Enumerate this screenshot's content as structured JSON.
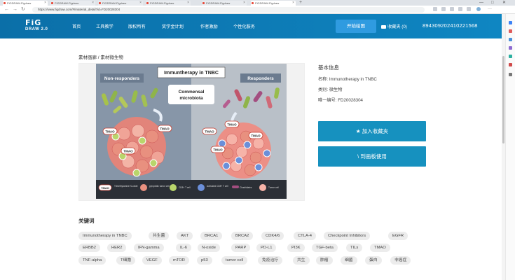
{
  "browser": {
    "tabs": [
      "FIGDRAW-Figdraw",
      "FIGDRAW-Figdraw",
      "FIGDRAW-Figdraw",
      "FIGDRAW-Figdraw",
      "FIGDRAW-Figdraw",
      "FIGDRAW-Figdraw"
    ],
    "new_tab": "+",
    "url": "https://www.figdraw.com/#/material_detail?id=FD20028304",
    "window_controls": [
      "—",
      "□",
      "✕"
    ]
  },
  "header": {
    "logo_line1": "FiG",
    "logo_line2": "DRAW 2.0",
    "nav": [
      "首页",
      "工具教学",
      "版权所有",
      "奖学金计划",
      "作者激励",
      "个性化服务"
    ],
    "start_button": "开始绘图",
    "favorites": "收藏夹 (0)",
    "user_id": "8943092024102215​68"
  },
  "breadcrumb": "素材画廊 / 素材微生物",
  "figure": {
    "title": "Immuntherapy in TNBC",
    "non_responders": "Non-responders",
    "responders": "Responders",
    "center_label_1": "Commensal",
    "center_label_2": "microbiota",
    "tmao": "TMAO",
    "legend": [
      {
        "icon": "TMAO",
        "label": "Trimethylamine N-oxide"
      },
      {
        "label": "pyroptotic tumor cell"
      },
      {
        "label": "CD8+ T cell"
      },
      {
        "label": "Activated CD8+ T cell"
      },
      {
        "label": "Clostridiales"
      },
      {
        "label": "Tumor cell"
      }
    ]
  },
  "info": {
    "title": "基本信息",
    "name_label": "名称: ",
    "name_value": "Immunotherapy in TNBC",
    "category_label": "类别: ",
    "category_value": "微生物",
    "id_label": "唯一编号: ",
    "id_value": "FD20028304",
    "favorite_button": "加入收藏夹",
    "use_button": "到画板使用"
  },
  "keywords": {
    "title": "关键词",
    "tags": [
      "Immunotherapy in TNBC",
      "共生菌",
      "AKT",
      "BRCA1",
      "BRCA2",
      "CDK4/6",
      "CTLA-4",
      "Checkpoint Inhibitors",
      "EGFR",
      "ERBB2",
      "HER2",
      "IFN-gamma",
      "IL-6",
      "N-oxide",
      "PARP",
      "PD-L1",
      "PI3K",
      "TGF-beta",
      "TILs",
      "TMAO",
      "TNF-alpha",
      "T细胞",
      "VEGF",
      "mTOR",
      "p53",
      "tumor cell",
      "免疫治疗",
      "共生",
      "肿瘤",
      "细菌",
      "蛋白",
      "非癌症"
    ]
  },
  "colors": {
    "header_start": "#0b6fa8",
    "header_end": "#0f86c2",
    "button": "#1691bf",
    "left_panel": "#8796a8",
    "right_panel": "#b9c0c8"
  }
}
